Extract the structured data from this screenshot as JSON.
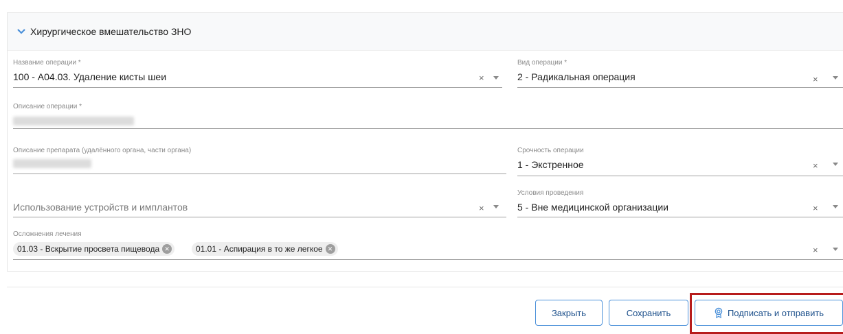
{
  "section": {
    "title": "Хирургическое вмешательство ЗНО"
  },
  "fields": {
    "operation_name": {
      "label": "Название операции *",
      "value": "100 - А04.03. Удаление кисты шеи"
    },
    "operation_type": {
      "label": "Вид операции *",
      "value": "2 - Радикальная операция"
    },
    "operation_description": {
      "label": "Описание операции *"
    },
    "preparation_description": {
      "label": "Описание препарата (удалённого органа, части органа)"
    },
    "urgency": {
      "label": "Срочность операции",
      "value": "1 - Экстренное"
    },
    "devices": {
      "placeholder": "Использование устройств и имплантов"
    },
    "conditions": {
      "label": "Условия проведения",
      "value": "5 - Вне медицинской организации"
    },
    "complications": {
      "label": "Осложнения лечения",
      "chips": [
        "01.03 - Вскрытие просвета пищевода",
        "01.01 - Аспирация в то же легкое"
      ]
    }
  },
  "icons": {
    "clear": "×",
    "chip_remove": "✕"
  },
  "buttons": {
    "close": "Закрыть",
    "save": "Сохранить",
    "sign_send": "Подписать и отправить"
  },
  "colors": {
    "accent": "#4a90d9",
    "highlight": "#b71c1c",
    "chevron": "#4a90d9"
  }
}
